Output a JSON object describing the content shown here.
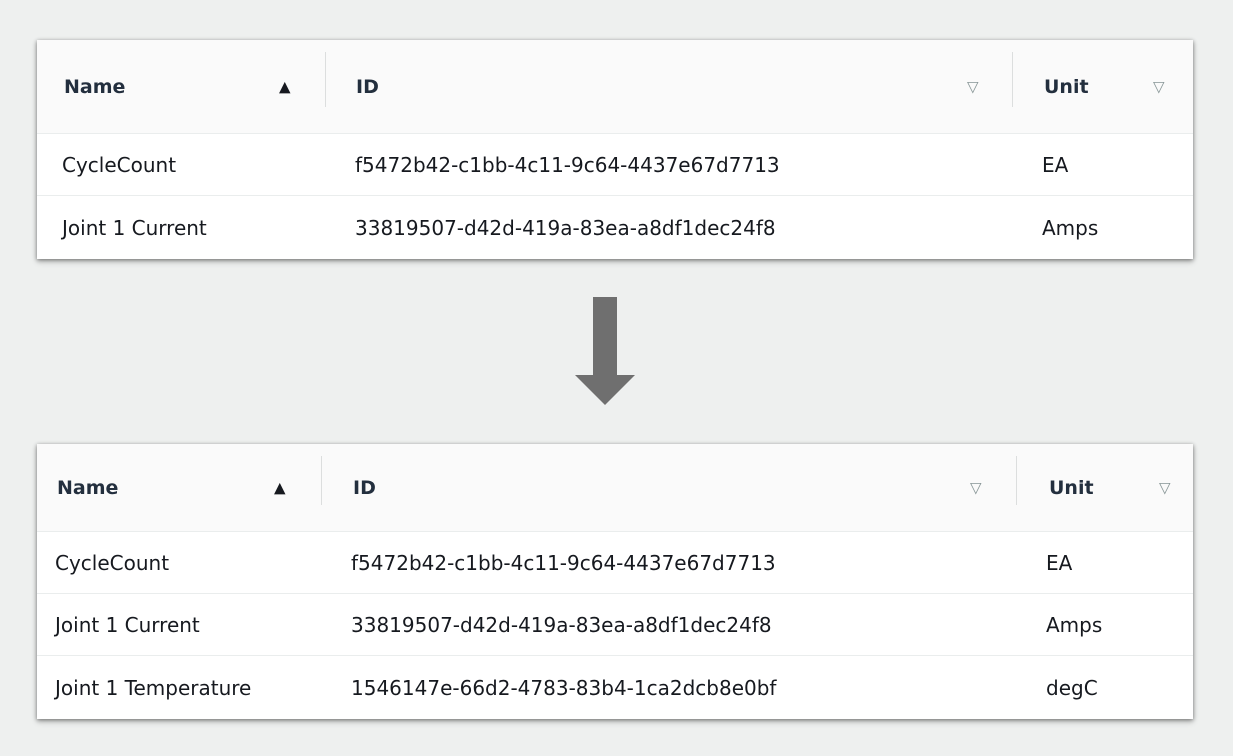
{
  "tables": [
    {
      "id": "before",
      "columns": [
        {
          "label": "Name",
          "sort": "ascending",
          "sort_icon": "sort-ascending-icon"
        },
        {
          "label": "ID",
          "sort": "none",
          "sort_icon": "sort-unsorted-icon"
        },
        {
          "label": "Unit",
          "sort": "none",
          "sort_icon": "sort-unsorted-icon"
        }
      ],
      "rows": [
        {
          "name": "CycleCount",
          "id": "f5472b42-c1bb-4c11-9c64-4437e67d7713",
          "unit": "EA"
        },
        {
          "name": "Joint 1 Current",
          "id": "33819507-d42d-419a-83ea-a8df1dec24f8",
          "unit": "Amps"
        }
      ]
    },
    {
      "id": "after",
      "columns": [
        {
          "label": "Name",
          "sort": "ascending",
          "sort_icon": "sort-ascending-icon"
        },
        {
          "label": "ID",
          "sort": "none",
          "sort_icon": "sort-unsorted-icon"
        },
        {
          "label": "Unit",
          "sort": "none",
          "sort_icon": "sort-unsorted-icon"
        }
      ],
      "rows": [
        {
          "name": "CycleCount",
          "id": "f5472b42-c1bb-4c11-9c64-4437e67d7713",
          "unit": "EA"
        },
        {
          "name": "Joint 1 Current",
          "id": "33819507-d42d-419a-83ea-a8df1dec24f8",
          "unit": "Amps"
        },
        {
          "name": "Joint 1 Temperature",
          "id": "1546147e-66d2-4783-83b4-1ca2dcb8e0bf",
          "unit": "degC"
        }
      ]
    }
  ],
  "icons": {
    "sort_ascending": "▲",
    "sort_unsorted": "▽",
    "transition_arrow": "down-arrow-icon"
  },
  "colors": {
    "background": "#eef0ef",
    "arrow": "#6f6f6f",
    "header_background": "#fafafa"
  }
}
